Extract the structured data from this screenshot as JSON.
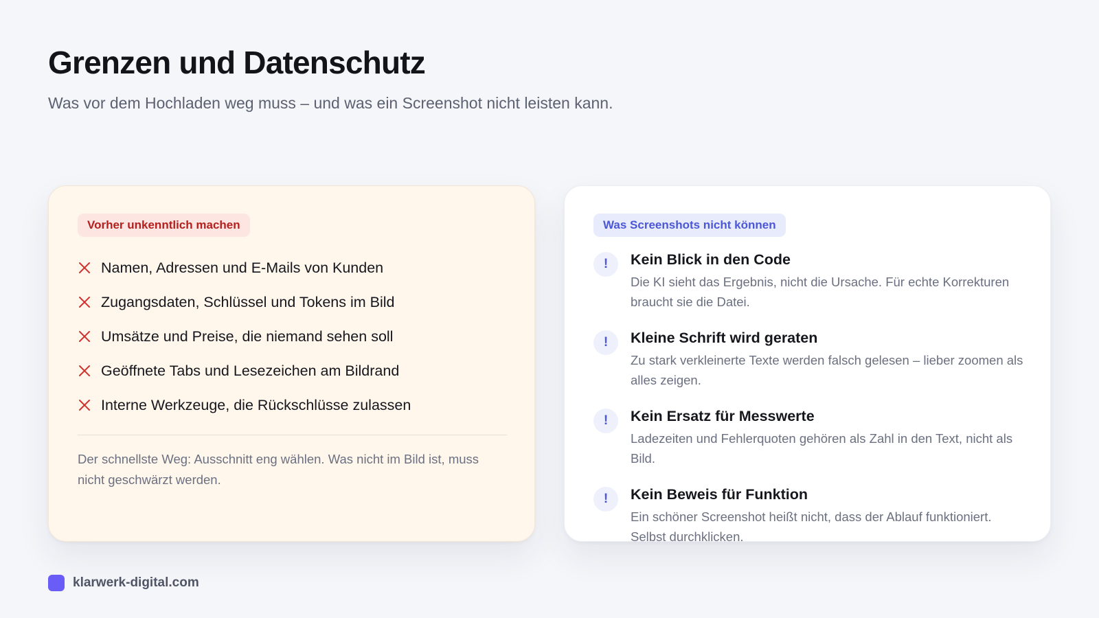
{
  "header": {
    "title": "Grenzen und Datenschutz",
    "subtitle": "Was vor dem Hochladen weg muss – und was ein Screenshot nicht leisten kann."
  },
  "left_card": {
    "badge": "Vorher unkenntlich machen",
    "items": [
      {
        "icon": "cross-icon",
        "text": "Namen, Adressen und E-Mails von Kunden"
      },
      {
        "icon": "cross-icon",
        "text": "Zugangsdaten, Schlüssel und Tokens im Bild"
      },
      {
        "icon": "cross-icon",
        "text": "Umsätze und Preise, die niemand sehen soll"
      },
      {
        "icon": "cross-icon",
        "text": "Geöffnete Tabs und Lesezeichen am Bildrand"
      },
      {
        "icon": "cross-icon",
        "text": "Interne Werkzeuge, die Rückschlüsse zulassen"
      }
    ],
    "note": "Der schnellste Weg: Ausschnitt eng wählen. Was nicht im Bild ist, muss nicht geschwärzt werden."
  },
  "right_card": {
    "badge": "Was Screenshots nicht können",
    "items": [
      {
        "icon": "exclamation-icon",
        "glyph": "!",
        "title": "Kein Blick in den Code",
        "desc": "Die KI sieht das Ergebnis, nicht die Ursache. Für echte Korrekturen braucht sie die Datei."
      },
      {
        "icon": "exclamation-icon",
        "glyph": "!",
        "title": "Kleine Schrift wird geraten",
        "desc": "Zu stark verkleinerte Texte werden falsch gelesen – lieber zoomen als alles zeigen."
      },
      {
        "icon": "exclamation-icon",
        "glyph": "!",
        "title": "Kein Ersatz für Messwerte",
        "desc": "Ladezeiten und Fehlerquoten gehören als Zahl in den Text, nicht als Bild."
      },
      {
        "icon": "exclamation-icon",
        "glyph": "!",
        "title": "Kein Beweis für Funktion",
        "desc": "Ein schöner Screenshot heißt nicht, dass der Ablauf funktioniert. Selbst durchklicken."
      }
    ]
  },
  "footer": {
    "brand": "klarwerk-digital.com"
  },
  "colors": {
    "background": "#f5f6fa",
    "warning_card_bg": "#fff6ec",
    "cross_red": "#d0312d",
    "accent_blue": "#4b57d6",
    "brand_purple": "#6a5cf6"
  }
}
